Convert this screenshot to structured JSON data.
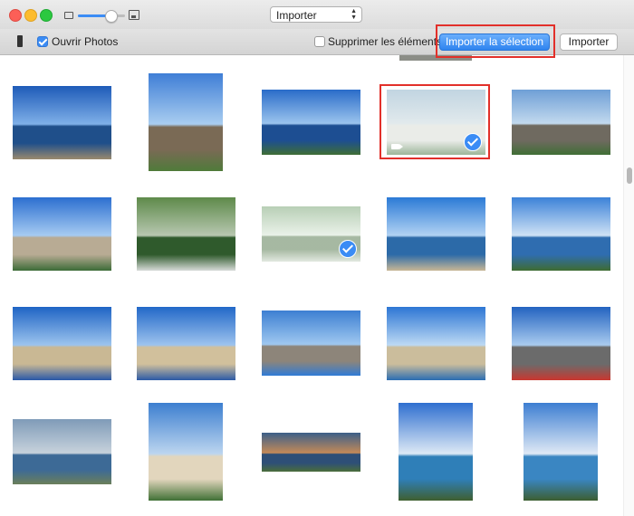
{
  "toolbar": {
    "import_select_label": "Importer",
    "open_photos_label": "Ouvrir Photos",
    "open_photos_checked": true,
    "delete_items_label": "Supprimer les éléments",
    "delete_items_checked": false,
    "import_selection_label": "Importer la sélection",
    "import_label": "Importer"
  },
  "zoom": {
    "level": 0.7
  },
  "colors": {
    "accent": "#3b8cf5",
    "highlight": "#e2302a"
  },
  "photos": [
    {
      "row": 0,
      "col": 0,
      "sky": [
        "#1e5bb8",
        "#7fb0e8"
      ],
      "ground": "#1f4f8a",
      "shore": "#9a8a6e",
      "selected": false,
      "video": false
    },
    {
      "row": 0,
      "col": 1,
      "sky": [
        "#3f7ed6",
        "#a9cdf0"
      ],
      "ground": "#7a6a55",
      "shore": "#4f7b3a",
      "selected": false,
      "video": false
    },
    {
      "row": 0,
      "col": 2,
      "sky": [
        "#2a6cc8",
        "#9bc4ee"
      ],
      "ground": "#1d4e92",
      "shore": "#3f6e35",
      "selected": false,
      "video": false
    },
    {
      "row": 0,
      "col": 3,
      "sky": [
        "#8fb2c9",
        "#c9d8dd"
      ],
      "ground": "#d9dcd6",
      "shore": "#4c7a46",
      "selected": true,
      "video": true
    },
    {
      "row": 0,
      "col": 4,
      "sky": [
        "#6f9fd6",
        "#c2d9ee"
      ],
      "ground": "#6f6a60",
      "shore": "#3f6e35",
      "selected": false,
      "video": false
    },
    {
      "row": 1,
      "col": 0,
      "sky": [
        "#2c6fd0",
        "#a6cbf2"
      ],
      "ground": "#b8ab94",
      "shore": "#3b6b37",
      "selected": false,
      "video": false
    },
    {
      "row": 1,
      "col": 1,
      "sky": [
        "#5e8a4a",
        "#b7c7b0"
      ],
      "ground": "#2f5a2c",
      "shore": "#d7dbd8",
      "selected": false,
      "video": false
    },
    {
      "row": 1,
      "col": 2,
      "sky": [
        "#7ea87a",
        "#d8e6d6"
      ],
      "ground": "#5d7f55",
      "shore": "#c9d6c6",
      "selected": true,
      "video": false
    },
    {
      "row": 1,
      "col": 3,
      "sky": [
        "#2b7ad6",
        "#b1d2f3"
      ],
      "ground": "#2c6aa8",
      "shore": "#c8b795",
      "selected": false,
      "video": false
    },
    {
      "row": 1,
      "col": 4,
      "sky": [
        "#3c82d8",
        "#cfe2f5"
      ],
      "ground": "#2f6db0",
      "shore": "#3e6c31",
      "selected": false,
      "video": false
    },
    {
      "row": 2,
      "col": 0,
      "sky": [
        "#1f64c4",
        "#9cc4ee"
      ],
      "ground": "#c9b894",
      "shore": "#2a58a8",
      "selected": false,
      "video": false
    },
    {
      "row": 2,
      "col": 1,
      "sky": [
        "#2268c8",
        "#9dc3ee"
      ],
      "ground": "#d1c09c",
      "shore": "#2c5aa6",
      "selected": false,
      "video": false
    },
    {
      "row": 2,
      "col": 2,
      "sky": [
        "#3d7fd2",
        "#9fc8f0"
      ],
      "ground": "#8d857a",
      "shore": "#2f7bd6",
      "selected": false,
      "video": false
    },
    {
      "row": 2,
      "col": 3,
      "sky": [
        "#2d76d4",
        "#bcd9f4"
      ],
      "ground": "#cbbd9c",
      "shore": "#2b6db2",
      "selected": false,
      "video": false
    },
    {
      "row": 2,
      "col": 4,
      "sky": [
        "#2363c0",
        "#a9cbef"
      ],
      "ground": "#6b6b6b",
      "shore": "#c9372f",
      "selected": false,
      "video": false
    },
    {
      "row": 3,
      "col": 0,
      "sky": [
        "#7f9bb8",
        "#c7d2dc"
      ],
      "ground": "#3d6a96",
      "shore": "#6b7f5a",
      "selected": false,
      "video": false
    },
    {
      "row": 3,
      "col": 1,
      "sky": [
        "#3d7fd0",
        "#bcd5ef"
      ],
      "ground": "#e2d6bd",
      "shore": "#3f7035",
      "selected": false,
      "video": false
    },
    {
      "row": 3,
      "col": 2,
      "sky": [
        "#3c5f88",
        "#c48a58"
      ],
      "ground": "#2e4f77",
      "shore": "#4b6e3a",
      "selected": false,
      "video": false
    },
    {
      "row": 3,
      "col": 3,
      "sky": [
        "#2f6fd0",
        "#dde9f5"
      ],
      "ground": "#2f7fb8",
      "shore": "#3f5f2f",
      "selected": false,
      "video": false
    },
    {
      "row": 3,
      "col": 4,
      "sky": [
        "#3d7ed2",
        "#dfe9f5"
      ],
      "ground": "#3a86c2",
      "shore": "#3c5e30",
      "selected": false,
      "video": false
    }
  ]
}
